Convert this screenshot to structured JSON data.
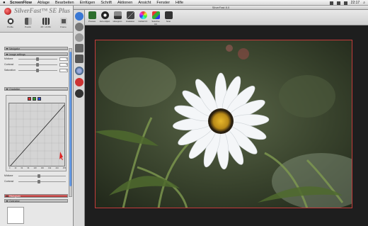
{
  "menubar": {
    "apple": "",
    "app": "ScreenFlow",
    "items": [
      "Ablage",
      "Bearbeiten",
      "Einfügen",
      "Schrift",
      "Aktionen",
      "Ansicht",
      "Fenster",
      "Hilfe"
    ],
    "clock": "22:17"
  },
  "window": {
    "title": "SilverFast 8.0"
  },
  "brand": {
    "name": "SilverFast",
    "edition": "SE Plus"
  },
  "left_tools": [
    {
      "label": "Profile",
      "icon": "profile-icon"
    },
    {
      "label": "Positiv",
      "icon": "positive-icon"
    },
    {
      "label": "48 > 24 Bit",
      "icon": "film-icon"
    },
    {
      "label": "Frame",
      "icon": "frame-icon"
    }
  ],
  "panels": {
    "navigator": "Navigator",
    "image_settings": "Image settings",
    "gradation": "Gradation",
    "histogram": "Histogram",
    "overview": "Overview"
  },
  "sliders": [
    {
      "label": "Midtone",
      "value": "0",
      "position": 0.45
    },
    {
      "label": "Contrast",
      "value": "0",
      "position": 0.45
    },
    {
      "label": "Saturation",
      "value": "0",
      "position": 0.45
    }
  ],
  "gradation": {
    "swatches": [
      "#d83030",
      "#30a030",
      "#3050d8"
    ],
    "labels": [
      "0",
      "32",
      "64",
      "96",
      "128",
      "160",
      "192",
      "224",
      "255"
    ],
    "midtone_label": "Midtone",
    "contrast_label": "Contrast"
  },
  "toolbar": [
    {
      "label": "Preview",
      "icon": "preview-icon"
    },
    {
      "label": "Auto-Adjust",
      "icon": "auto-icon"
    },
    {
      "label": "Histogram",
      "icon": "histogram-icon"
    },
    {
      "label": "Gradation",
      "icon": "gradation-icon"
    },
    {
      "label": "Global CC",
      "icon": "global-color-icon"
    },
    {
      "label": "Selective CC",
      "icon": "selective-color-icon"
    },
    {
      "label": "Scan",
      "icon": "scan-icon"
    }
  ],
  "side_tools": [
    "zoom-icon",
    "lock-icon",
    "crop-icon",
    "densito-icon",
    "info-icon",
    "eyedropper-icon",
    "color-icon"
  ],
  "colors": {
    "frame": "#c43b3b",
    "accent": "#3a78d4"
  }
}
